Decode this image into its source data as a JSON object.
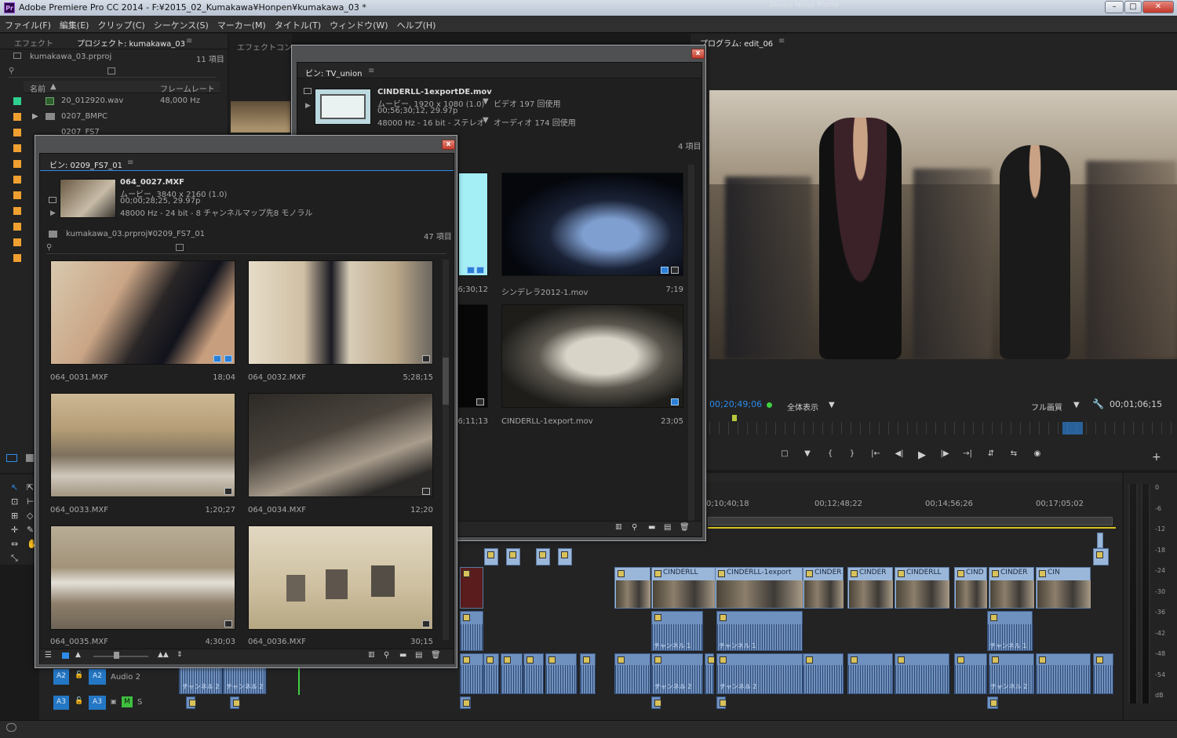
{
  "window": {
    "title": "Adobe Premiere Pro CC 2014 - F:¥2015_02_Kumakawa¥Honpen¥kumakawa_03 *",
    "app_icon": "Pr",
    "profile_label": "Device Noise Profile",
    "controls": [
      "–",
      "□",
      "✕"
    ]
  },
  "menu": [
    "ファイル(F)",
    "編集(E)",
    "クリップ(C)",
    "シーケンス(S)",
    "マーカー(M)",
    "タイトル(T)",
    "ウィンドウ(W)",
    "ヘルプ(H)"
  ],
  "project_panel": {
    "tabs": [
      "エフェクト",
      "プロジェクト: kumakawa_03",
      "エフェクトコン"
    ],
    "menu_icon": "≡",
    "project_file": "kumakawa_03.prproj",
    "item_count": "11 項目",
    "columns": [
      "名前",
      "フレームレート"
    ],
    "rows": [
      {
        "color": "#2ecf8f",
        "icon": "audio-file-icon",
        "name": "20_012920.wav",
        "rate": "48,000 Hz"
      },
      {
        "color": "#f0a030",
        "icon": "folder-icon",
        "name": "0207_BMPC",
        "rate": ""
      },
      {
        "color": "#f0a030",
        "icon": "folder-icon",
        "name": "0207_FS7",
        "rate": ""
      }
    ],
    "extra_swatch_count": 8,
    "swatch_color": "#f0a030"
  },
  "program_monitor": {
    "tab": "プログラム: edit_06",
    "timecode_in": "00;20;49;06",
    "zoom": "全体表示",
    "quality": "フル画質",
    "timecode_duration": "00;01;06;15",
    "buttons": [
      "□",
      "▼",
      "{",
      "}",
      "|←",
      "◀|",
      "▶",
      "|▶",
      "→|",
      "⇵",
      "⇆",
      "◉"
    ],
    "add_button": "+"
  },
  "bin_tv_union": {
    "tab": "ビン: TV_union",
    "menu_icon": "≡",
    "close": "x",
    "preview": {
      "name": "CINDERLL-1exportDE.mov",
      "line1": "ムービー, 1920 x 1080 (1.0)",
      "line1b": "ビデオ 197 回使用",
      "line2": "00;56;30;12, 29.97p",
      "line3": "48000 Hz - 16 bit - ステレオ",
      "line3b": "オーディオ 174 回使用"
    },
    "item_count": "4 項目",
    "clips": [
      {
        "name": "",
        "duration": "6;30;12"
      },
      {
        "name": "シンデレラ2012-1.mov",
        "duration": "7;19"
      },
      {
        "name": "",
        "duration": "6;11;13"
      },
      {
        "name": "CINDERLL-1export.mov",
        "duration": "23;05"
      }
    ]
  },
  "bin_fs7": {
    "tab": "ビン: 0209_FS7_01",
    "menu_icon": "≡",
    "close": "x",
    "preview": {
      "name": "064_0027.MXF",
      "line1": "ムービー, 3840 x 2160 (1.0)",
      "line2": "00;00;28;25, 29.97p",
      "line3": "48000 Hz - 24 bit - 8 チャンネルマップ先8 モノラル"
    },
    "path": "kumakawa_03.prproj¥0209_FS7_01",
    "item_count": "47 項目",
    "clips": [
      {
        "name": "064_0031.MXF",
        "duration": "18;04"
      },
      {
        "name": "064_0032.MXF",
        "duration": "5;28;15"
      },
      {
        "name": "064_0033.MXF",
        "duration": "1;20;27"
      },
      {
        "name": "064_0034.MXF",
        "duration": "12;20"
      },
      {
        "name": "064_0035.MXF",
        "duration": "4;30;03"
      },
      {
        "name": "064_0036.MXF",
        "duration": "30;15"
      }
    ]
  },
  "timeline": {
    "ruler": [
      "0;10;40;18",
      "00;12;48;22",
      "00;14;56;26",
      "00;17;05;02"
    ],
    "video_clip_labels": [
      "CINDERLL",
      "CINDERLL-1export",
      "CINDER",
      "CINDER",
      "CINDERLL",
      "CIND",
      "CINDER",
      "CIN"
    ],
    "channel_labels": [
      "チャンネル 1",
      "チャンネル 1",
      "チャンネル 1",
      "チャンネル 2",
      "チャンネル 2",
      "チャンネル 2",
      "チャンネル 2",
      "チャンネル 2"
    ],
    "tracks": [
      {
        "label": "A2",
        "target": "A2",
        "name": "Audio 2"
      },
      {
        "label": "A3",
        "target": "A3",
        "name": "",
        "m": "M",
        "s": "S"
      }
    ]
  },
  "meters": {
    "scale": [
      "0",
      "-6",
      "-12",
      "-18",
      "-24",
      "-30",
      "-36",
      "-42",
      "-48",
      "-54",
      "dB"
    ]
  },
  "colors": {
    "accent_blue": "#2d8ceb",
    "timecode_blue": "#2d8ceb",
    "video_clip": "#9ab7da",
    "audio_clip": "#6f91bf"
  }
}
